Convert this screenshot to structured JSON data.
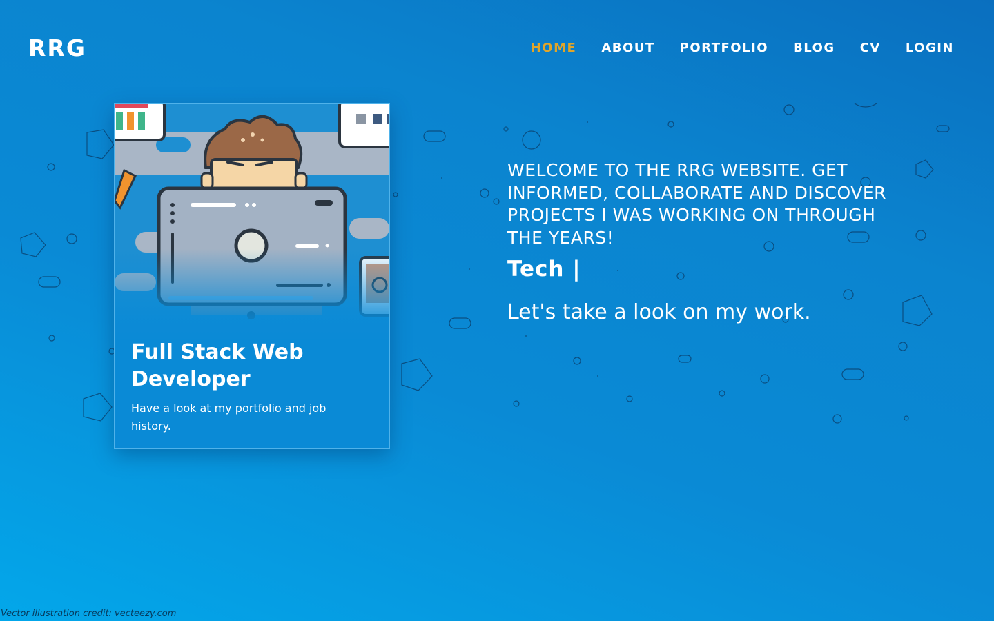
{
  "header": {
    "logo": "RRG",
    "nav": [
      {
        "label": "HOME",
        "active": true
      },
      {
        "label": "ABOUT",
        "active": false
      },
      {
        "label": "PORTFOLIO",
        "active": false
      },
      {
        "label": "BLOG",
        "active": false
      },
      {
        "label": "CV",
        "active": false
      },
      {
        "label": "LOGIN",
        "active": false
      }
    ]
  },
  "card": {
    "title": "Full Stack Web Developer",
    "description": "Have a look at my portfolio and job history.",
    "illustration": "developer-at-computer-illustration"
  },
  "hero": {
    "welcome": "WELCOME TO THE RRG WEBSITE. GET INFORMED, COLLABORATE AND DISCOVER PROJECTS I WAS WORKING ON THROUGH THE YEARS!",
    "typed_text": "Tech |",
    "tagline": "Let's take a look on my work."
  },
  "footer": {
    "credit": "Vector illustration credit: vecteezy.com"
  },
  "colors": {
    "accent_active_nav": "#e0a52a",
    "background_top": "#0a6fbf",
    "background_bottom": "#03a7ea",
    "text": "#ffffff"
  }
}
